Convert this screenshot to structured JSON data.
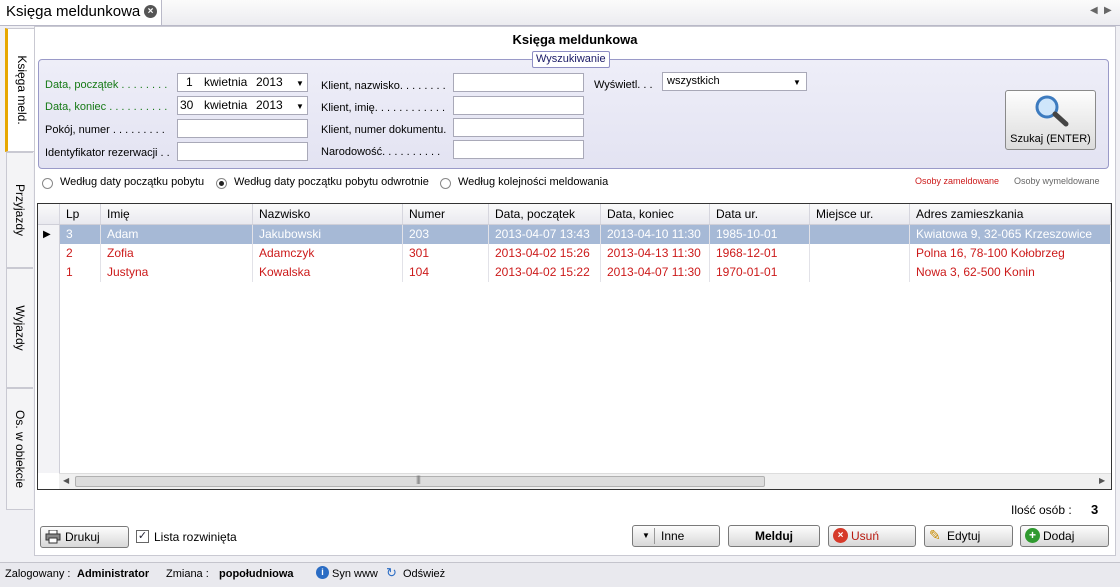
{
  "tab": {
    "title": "Księga meldunkowa"
  },
  "vertical_tabs": [
    "Księga meld.",
    "Przyjazdy",
    "Wyjazdy",
    "Os. w obiekcie"
  ],
  "page_title": "Księga meldunkowa",
  "search": {
    "legend": "Wyszukiwanie",
    "labels": {
      "date_start": "Data, początek . . . . . . . .",
      "date_end": "Data, koniec . . . . . . . . . .",
      "room": "Pokój, numer . . . . . . . . .",
      "reservation_id": "Identyfikator rezerwacji . .",
      "client_surname": "Klient, nazwisko. . . . . . . .",
      "client_name": "Klient, imię. . . . . . . . . . . .",
      "client_doc": "Klient, numer dokumentu.",
      "nationality": "Narodowość. . . . . . . . . .",
      "show": "Wyświetl. . ."
    },
    "date_start": {
      "day": "1",
      "month": "kwietnia",
      "year": "2013"
    },
    "date_end": {
      "day": "30",
      "month": "kwietnia",
      "year": "2013"
    },
    "room_value": "",
    "reservation_value": "",
    "client_surname_value": "",
    "client_name_value": "",
    "client_doc_value": "",
    "nationality_value": "",
    "show_value": "wszystkich",
    "button": "Szukaj (ENTER)"
  },
  "sort_options": [
    {
      "label": "Według daty początku pobytu",
      "selected": false
    },
    {
      "label": "Według daty początku pobytu odwrotnie",
      "selected": true
    },
    {
      "label": "Według kolejności meldowania",
      "selected": false
    }
  ],
  "legend": {
    "checked_in": "Osoby zameldowane",
    "checked_out": "Osoby wymeldowane",
    "checked_in_color": "#cc1a1a",
    "checked_out_color": "#666666"
  },
  "table": {
    "columns": [
      "Lp",
      "Imię",
      "Nazwisko",
      "Numer",
      "Data, początek",
      "Data, koniec",
      "Data ur.",
      "Miejsce ur.",
      "Adres zamieszkania"
    ],
    "rows": [
      {
        "cells": [
          "3",
          "Adam",
          "Jakubowski",
          "203",
          "2013-04-07 13:43",
          "2013-04-10 11:30",
          "1985-10-01",
          "",
          "Kwiatowa 9, 32-065 Krzeszowice"
        ],
        "status": "selected"
      },
      {
        "cells": [
          "2",
          "Zofia",
          "Adamczyk",
          "301",
          "2013-04-02 15:26",
          "2013-04-13 11:30",
          "1968-12-01",
          "",
          "Polna 16, 78-100 Kołobrzeg"
        ],
        "status": "checked_in"
      },
      {
        "cells": [
          "1",
          "Justyna",
          "Kowalska",
          "104",
          "2013-04-02 15:22",
          "2013-04-07 11:30",
          "1970-01-01",
          "",
          "Nowa 3, 62-500 Konin"
        ],
        "status": "checked_in"
      }
    ]
  },
  "count": {
    "label": "Ilość osób :",
    "value": "3"
  },
  "footer": {
    "print": "Drukuj",
    "expanded_list": "Lista rozwinięta",
    "expanded_checked": true,
    "other": "Inne",
    "checkin": "Melduj",
    "delete": "Usuń",
    "edit": "Edytuj",
    "add": "Dodaj"
  },
  "status": {
    "logged_label": "Zalogowany :",
    "logged_user": "Administrator",
    "shift_label": "Zmiana :",
    "shift_value": "popołudniowa",
    "sync": "Syn www",
    "refresh": "Odśwież"
  }
}
